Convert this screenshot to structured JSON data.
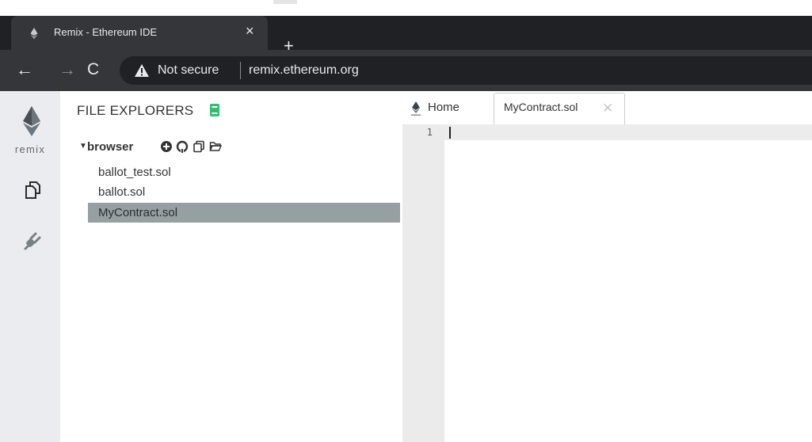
{
  "browser": {
    "tab_title": "Remix - Ethereum IDE",
    "tab_close": "×",
    "new_tab": "+",
    "back": "←",
    "forward": "→",
    "reload": "C",
    "security_label": "Not secure",
    "url": "remix.ethereum.org"
  },
  "icon_panel": {
    "logo_text": "remix",
    "icons": [
      "ethereum-logo-icon",
      "file-explorer-icon",
      "plugin-manager-icon"
    ]
  },
  "file_explorer": {
    "title": "FILE EXPLORERS",
    "workspace": "browser",
    "toolbar_icons": [
      "create-file-icon",
      "github-icon",
      "copy-icon",
      "open-folder-icon"
    ],
    "files": [
      {
        "name": "ballot_test.sol",
        "selected": false
      },
      {
        "name": "ballot.sol",
        "selected": false
      },
      {
        "name": "MyContract.sol",
        "selected": true
      }
    ]
  },
  "editor": {
    "tabs": [
      {
        "label": "Home"
      },
      {
        "label": "MyContract.sol",
        "close": "✕"
      }
    ],
    "line_numbers": [
      "1"
    ]
  },
  "colors": {
    "selected_file_bg": "#969fa2",
    "icon_panel_bg": "#eaecef",
    "book_icon": "#2fbf71"
  }
}
